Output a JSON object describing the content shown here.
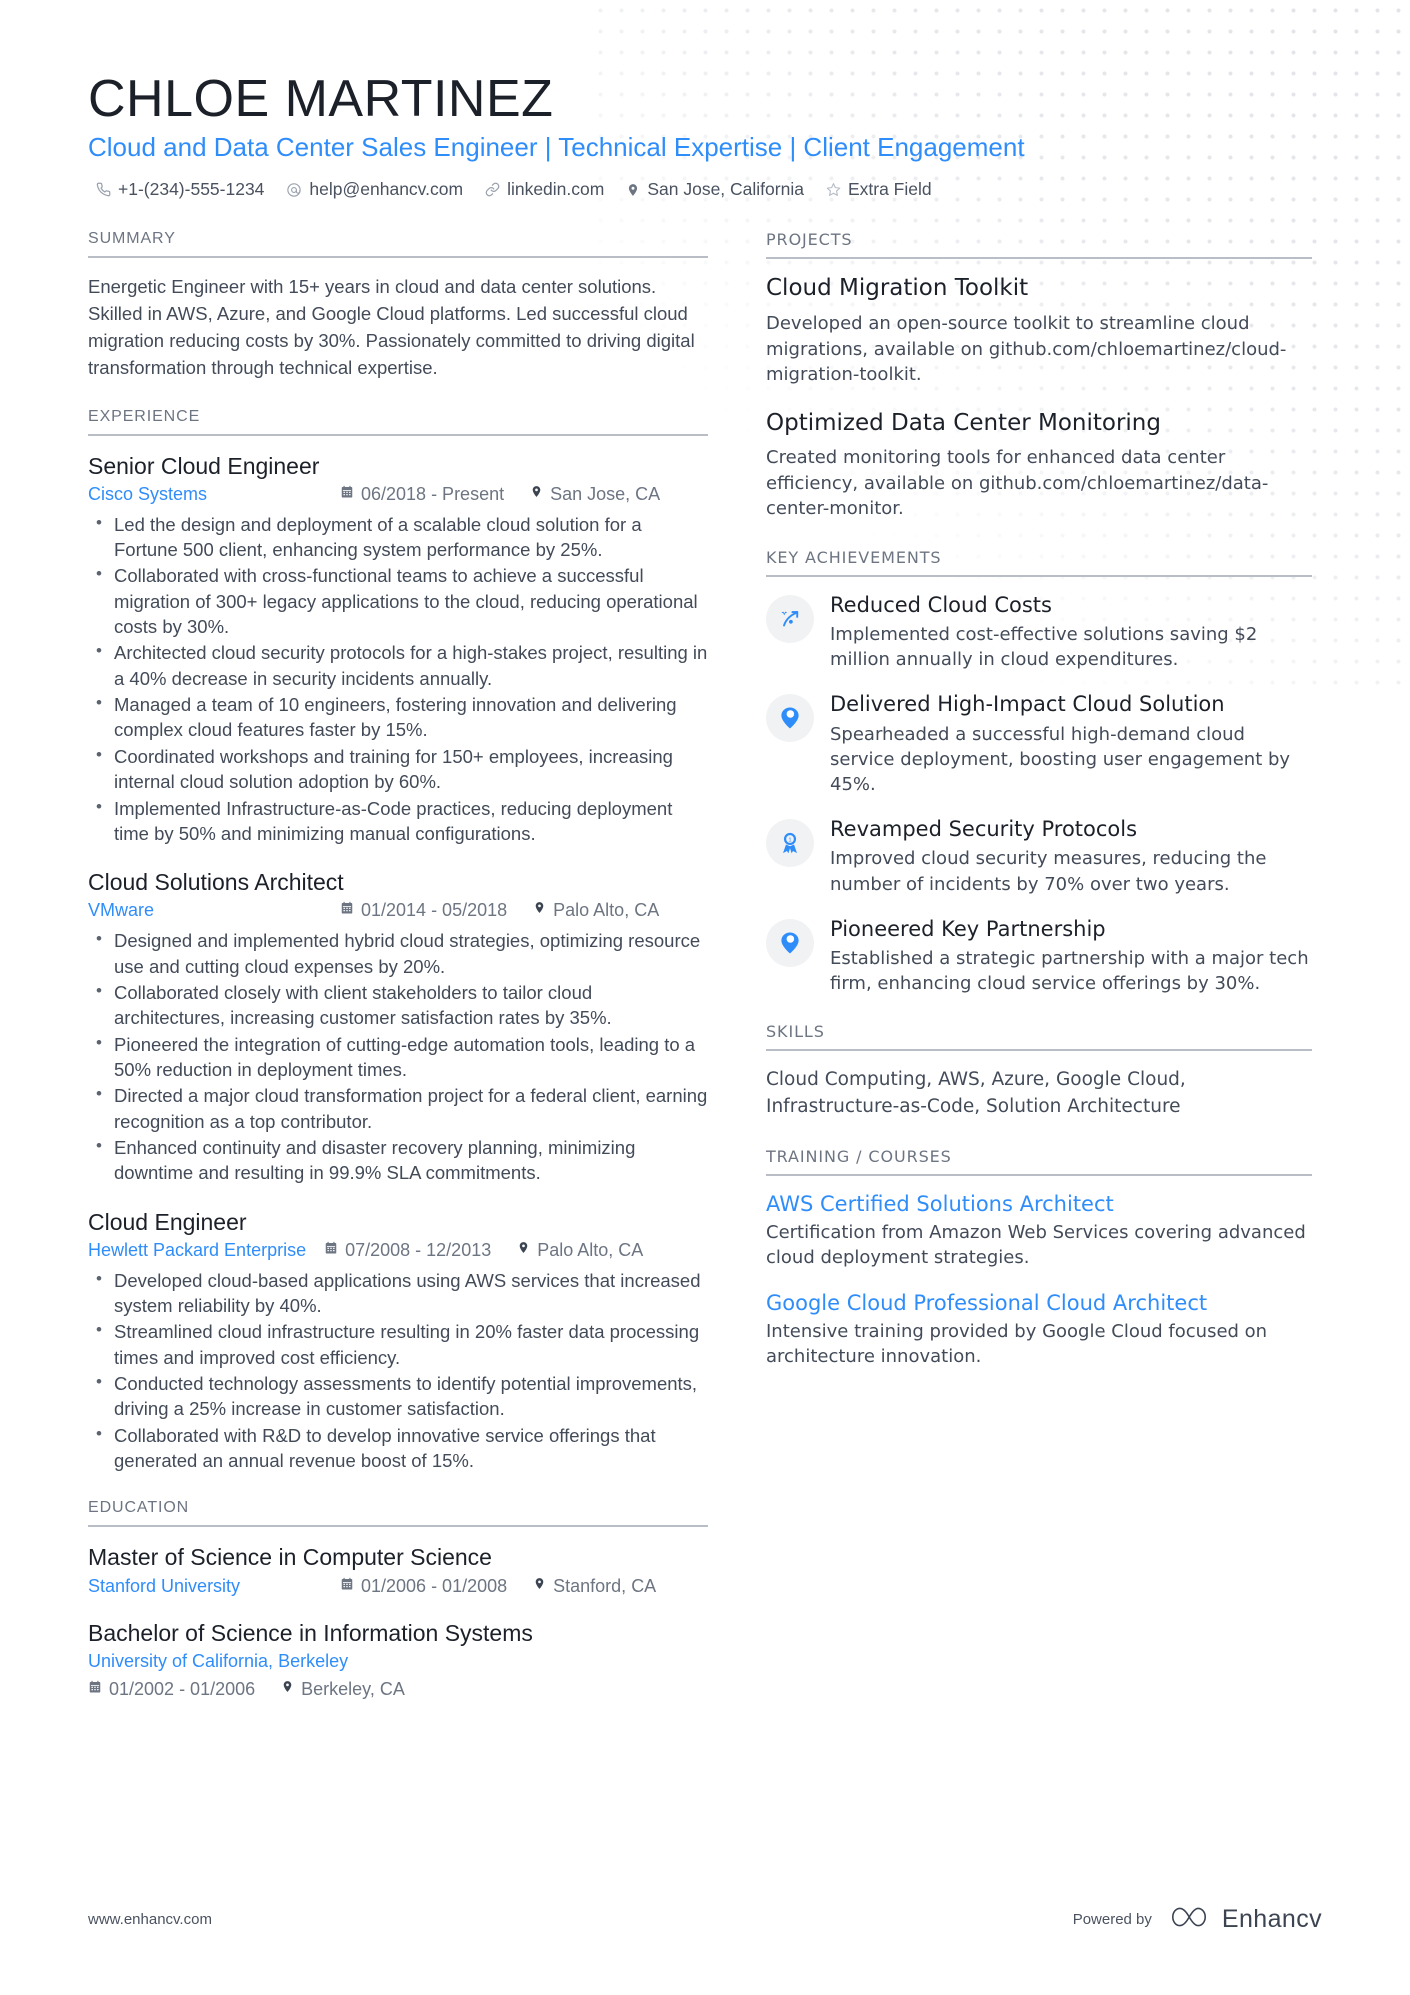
{
  "header": {
    "name": "CHLOE MARTINEZ",
    "headline": "Cloud and Data Center Sales Engineer | Technical Expertise | Client Engagement",
    "contacts": [
      {
        "icon": "phone-icon",
        "text": "+1-(234)-555-1234"
      },
      {
        "icon": "email-icon",
        "text": "help@enhancv.com"
      },
      {
        "icon": "link-icon",
        "text": "linkedin.com"
      },
      {
        "icon": "location-pin-icon",
        "text": "San Jose, California"
      },
      {
        "icon": "star-icon",
        "text": "Extra Field"
      }
    ]
  },
  "summary": {
    "title": "SUMMARY",
    "text": "Energetic Engineer with 15+ years in cloud and data center solutions. Skilled in AWS, Azure, and Google Cloud platforms. Led successful cloud migration reducing costs by 30%. Passionately committed to driving digital transformation through technical expertise."
  },
  "experience": {
    "title": "EXPERIENCE",
    "entries": [
      {
        "role": "Senior Cloud Engineer",
        "company": "Cisco Systems",
        "dates": "06/2018 - Present",
        "location": "San Jose, CA",
        "bullets": [
          "Led the design and deployment of a scalable cloud solution for a Fortune 500 client, enhancing system performance by 25%.",
          "Collaborated with cross-functional teams to achieve a successful migration of 300+ legacy applications to the cloud, reducing operational costs by 30%.",
          "Architected cloud security protocols for a high-stakes project, resulting in a 40% decrease in security incidents annually.",
          "Managed a team of 10 engineers, fostering innovation and delivering complex cloud features faster by 15%.",
          "Coordinated workshops and training for 150+ employees, increasing internal cloud solution adoption by 60%.",
          "Implemented Infrastructure-as-Code practices, reducing deployment time by 50% and minimizing manual configurations."
        ]
      },
      {
        "role": "Cloud Solutions Architect",
        "company": "VMware",
        "dates": "01/2014 - 05/2018",
        "location": "Palo Alto, CA",
        "bullets": [
          "Designed and implemented hybrid cloud strategies, optimizing resource use and cutting cloud expenses by 20%.",
          "Collaborated closely with client stakeholders to tailor cloud architectures, increasing customer satisfaction rates by 35%.",
          "Pioneered the integration of cutting-edge automation tools, leading to a 50% reduction in deployment times.",
          "Directed a major cloud transformation project for a federal client, earning recognition as a top contributor.",
          "Enhanced continuity and disaster recovery planning, minimizing downtime and resulting in 99.9% SLA commitments."
        ]
      },
      {
        "role": "Cloud Engineer",
        "company": "Hewlett Packard Enterprise",
        "dates": "07/2008 - 12/2013",
        "location": "Palo Alto, CA",
        "bullets": [
          "Developed cloud-based applications using AWS services that increased system reliability by 40%.",
          "Streamlined cloud infrastructure resulting in 20% faster data processing times and improved cost efficiency.",
          "Conducted technology assessments to identify potential improvements, driving a 25% increase in customer satisfaction.",
          "Collaborated with R&D to develop innovative service offerings that generated an annual revenue boost of 15%."
        ]
      }
    ]
  },
  "education": {
    "title": "EDUCATION",
    "entries": [
      {
        "degree": "Master of Science in Computer Science",
        "school": "Stanford University",
        "dates": "01/2006 - 01/2008",
        "location": "Stanford, CA",
        "wrapped": false
      },
      {
        "degree": "Bachelor of Science in Information Systems",
        "school": "University of California, Berkeley",
        "dates": "01/2002 - 01/2006",
        "location": "Berkeley, CA",
        "wrapped": true
      }
    ]
  },
  "projects": {
    "title": "PROJECTS",
    "entries": [
      {
        "name": "Cloud Migration Toolkit",
        "description": "Developed an open-source toolkit to streamline cloud migrations, available on github.com/chloemartinez/cloud-migration-toolkit."
      },
      {
        "name": "Optimized Data Center Monitoring",
        "description": "Created monitoring tools for enhanced data center efficiency, available on github.com/chloemartinez/data-center-monitor."
      }
    ]
  },
  "key_achievements": {
    "title": "KEY ACHIEVEMENTS",
    "entries": [
      {
        "icon": "trending-arrow-icon",
        "title": "Reduced Cloud Costs",
        "description": "Implemented cost-effective solutions saving $2 million annually in cloud expenditures."
      },
      {
        "icon": "map-pin-bubble-icon",
        "title": "Delivered High-Impact Cloud Solution",
        "description": "Spearheaded a successful high-demand cloud service deployment, boosting user engagement by 45%."
      },
      {
        "icon": "award-medal-icon",
        "title": "Revamped Security Protocols",
        "description": "Improved cloud security measures, reducing the number of incidents by 70% over two years."
      },
      {
        "icon": "map-pin-bubble-icon",
        "title": "Pioneered Key Partnership",
        "description": "Established a strategic partnership with a major tech firm, enhancing cloud service offerings by 30%."
      }
    ]
  },
  "skills": {
    "title": "SKILLS",
    "text": "Cloud Computing, AWS, Azure, Google Cloud, Infrastructure-as-Code, Solution Architecture"
  },
  "training": {
    "title": "TRAINING / COURSES",
    "entries": [
      {
        "name": "AWS Certified Solutions Architect",
        "description": "Certification from Amazon Web Services covering advanced cloud deployment strategies."
      },
      {
        "name": "Google Cloud Professional Cloud Architect",
        "description": "Intensive training provided by Google Cloud focused on architecture innovation."
      }
    ]
  },
  "footer": {
    "url": "www.enhancv.com",
    "powered_by": "Powered by",
    "brand": "Enhancv"
  },
  "colors": {
    "accent": "#2f8dfa",
    "heading": "#1c2029",
    "body": "#434b59",
    "muted": "#6d7582",
    "rule": "#b9bec6",
    "badge_bg": "#f1f2f4"
  }
}
